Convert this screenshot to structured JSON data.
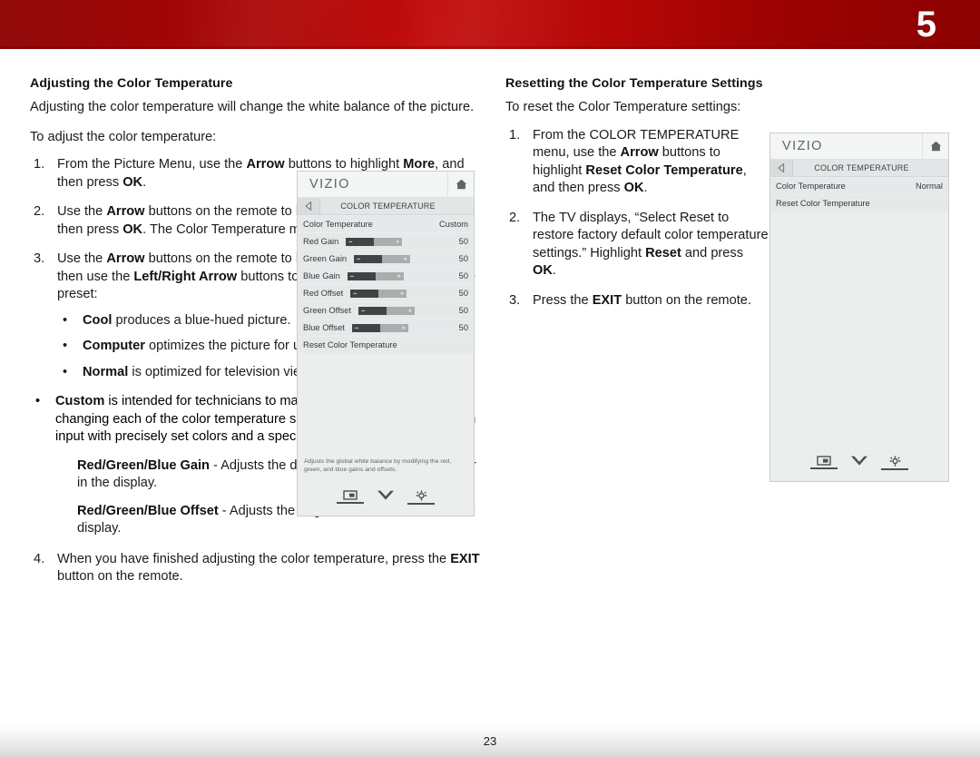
{
  "header": {
    "chapter_number": "5",
    "band_color_dark": "#8e0000",
    "band_color_light": "#c20c0c"
  },
  "footer": {
    "page_number": "23"
  },
  "left_column": {
    "title": "Adjusting the Color Temperature",
    "intro": "Adjusting the color temperature will change the white balance of the picture.",
    "lead_in": "To adjust the color temperature:",
    "steps": [
      {
        "num": "1.",
        "html": "From the Picture Menu, use the <b>Arrow</b> buttons to highlight <b>More</b>, and then press <b>OK</b>."
      },
      {
        "num": "2.",
        "html": "Use the <b>Arrow</b> buttons on the remote to highlight <b>Color Temperature</b>, then press <b>OK</b>. The Color Temperature menu is displayed."
      },
      {
        "num": "3.",
        "html": "Use the <b>Arrow</b> buttons on the remote to highlight <b>Color Temperature</b>, then use the <b>Left/Right Arrow</b> buttons to change the color temperature preset:"
      },
      {
        "num": "4.",
        "html": "When you have finished adjusting the color temperature, press the <b>EXIT</b> button on the remote."
      }
    ],
    "presets": [
      {
        "bullet": "•",
        "html": "<b>Cool</b> produces a blue-hued picture."
      },
      {
        "bullet": "•",
        "html": "<b>Computer</b> optimizes the picture for use as a PC monitor."
      },
      {
        "bullet": "•",
        "html": "<b>Normal</b> is optimized for television viewing."
      },
      {
        "bullet": "•",
        "html": "<b>Custom</b> is intended for technicians to manually calibrate the TV by changing each of the color temperature settings. Calibration requires an input with precisely set colors and a specialized light meter."
      }
    ],
    "sub_paragraphs": [
      {
        "html": "<b>Red/Green/Blue Gain</b> - Adjusts the degree of contrast of each color in the display."
      },
      {
        "html": "<b>Red/Green/Blue Offset</b> - Adjusts the brightness of each color in the display."
      }
    ]
  },
  "right_column": {
    "title": "Resetting the Color Temperature Settings",
    "lead_in": "To reset the Color Temperature settings:",
    "steps": [
      {
        "num": "1.",
        "html": "From the COLOR TEMPERATURE menu, use the <b>Arrow</b> buttons to highlight <b>Reset Color Temperature</b>, and then press <b>OK</b>."
      },
      {
        "num": "2.",
        "html": "The TV displays, “Select Reset to restore factory default color temperature settings.” Highlight <b>Reset</b> and press <b>OK</b>."
      },
      {
        "num": "3.",
        "html": "Press the <b>EXIT</b> button on the remote."
      }
    ]
  },
  "osd_left": {
    "brand": "VIZIO",
    "home_icon": "home-icon",
    "back_icon": "back-arrow-icon",
    "breadcrumb": "COLOR TEMPERATURE",
    "rows": [
      {
        "type": "value",
        "label": "Color Temperature",
        "value": "Custom"
      },
      {
        "type": "slider",
        "label": "Red Gain",
        "value": "50",
        "fill_percent": 50,
        "minus": "–",
        "plus": "+"
      },
      {
        "type": "slider",
        "label": "Green Gain",
        "value": "50",
        "fill_percent": 50,
        "minus": "–",
        "plus": "+"
      },
      {
        "type": "slider",
        "label": "Blue Gain",
        "value": "50",
        "fill_percent": 50,
        "minus": "–",
        "plus": "+"
      },
      {
        "type": "slider",
        "label": "Red Offset",
        "value": "50",
        "fill_percent": 50,
        "minus": "–",
        "plus": "+"
      },
      {
        "type": "slider",
        "label": "Green Offset",
        "value": "50",
        "fill_percent": 50,
        "minus": "–",
        "plus": "+"
      },
      {
        "type": "slider",
        "label": "Blue Offset",
        "value": "50",
        "fill_percent": 50,
        "minus": "–",
        "plus": "+"
      },
      {
        "type": "plain",
        "label": "Reset Color Temperature",
        "value": ""
      }
    ],
    "description": "Adjusts the global white balance by modifying the red, green, and blue gains and offsets.",
    "foot_icons": [
      "screen-icon",
      "chevron-down-icon",
      "gear-icon"
    ]
  },
  "osd_right": {
    "brand": "VIZIO",
    "home_icon": "home-icon",
    "back_icon": "back-arrow-icon",
    "breadcrumb": "COLOR TEMPERATURE",
    "rows": [
      {
        "type": "value",
        "label": "Color Temperature",
        "value": "Normal"
      },
      {
        "type": "plain",
        "label": "Reset Color Temperature",
        "value": ""
      }
    ],
    "description": "",
    "foot_icons": [
      "screen-icon",
      "chevron-down-icon",
      "gear-icon"
    ]
  }
}
